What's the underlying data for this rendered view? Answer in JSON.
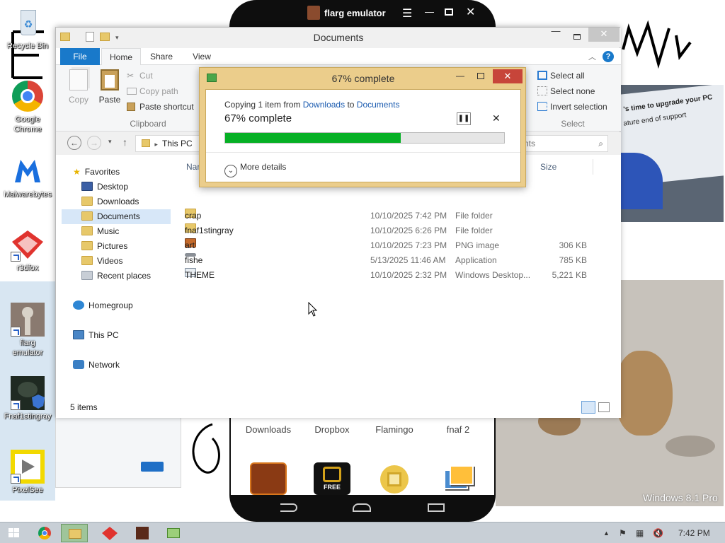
{
  "desktop": {
    "icons": [
      {
        "label": "Recycle Bin"
      },
      {
        "label": "Google Chrome"
      },
      {
        "label": "Malwarebytes"
      },
      {
        "label": "r3dfox"
      },
      {
        "label": "flarg emulator"
      },
      {
        "label": "Fnaf1stingray"
      },
      {
        "label": "PixelSee"
      }
    ],
    "watermark": "Windows 8.1 Pro",
    "bg_text_1": "'s time to upgrade your PC",
    "bg_text_2": "ature end of support"
  },
  "emulator": {
    "title": "flarg emulator",
    "apps": [
      "Downloads",
      "Dropbox",
      "Flamingo",
      "fnaf 2"
    ],
    "app_badge": "FREE"
  },
  "explorer": {
    "title": "Documents",
    "tabs": {
      "file": "File",
      "home": "Home",
      "share": "Share",
      "view": "View"
    },
    "ribbon": {
      "copy": "Copy",
      "paste": "Paste",
      "cut": "Cut",
      "copy_path": "Copy path",
      "paste_shortcut": "Paste shortcut",
      "clipboard_group": "Clipboard",
      "select_all": "Select all",
      "select_none": "Select none",
      "invert_selection": "Invert selection",
      "select_group": "Select"
    },
    "address": {
      "location": "This PC",
      "search_placeholder": "nts"
    },
    "nav": {
      "favorites": "Favorites",
      "desktop": "Desktop",
      "downloads": "Downloads",
      "documents": "Documents",
      "music": "Music",
      "pictures": "Pictures",
      "videos": "Videos",
      "recent": "Recent places",
      "homegroup": "Homegroup",
      "thispc": "This PC",
      "network": "Network"
    },
    "columns": {
      "name": "Nar",
      "size": "Size"
    },
    "files": [
      {
        "name": "crap",
        "date": "10/10/2025 7:42 PM",
        "type": "File folder",
        "size": ""
      },
      {
        "name": "fnaf1stingray",
        "date": "10/10/2025 6:26 PM",
        "type": "File folder",
        "size": ""
      },
      {
        "name": "art",
        "date": "10/10/2025 7:23 PM",
        "type": "PNG image",
        "size": "306 KB"
      },
      {
        "name": "fishe",
        "date": "5/13/2025 11:46 AM",
        "type": "Application",
        "size": "785 KB"
      },
      {
        "name": "THEME",
        "date": "10/10/2025 2:32 PM",
        "type": "Windows Desktop...",
        "size": "5,221 KB"
      }
    ],
    "status": "5 items"
  },
  "copy_dialog": {
    "title": "67% complete",
    "line_prefix": "Copying 1 item from",
    "from": "Downloads",
    "to_word": "to",
    "to": "Documents",
    "headline": "67% complete",
    "progress": 0.63,
    "more_details": "More details"
  },
  "taskbar": {
    "time": "7:42 PM"
  },
  "colors": {
    "accent": "#1979ca",
    "progress": "#06b025",
    "dialog_frame": "#ebcd8b",
    "taskbar": "#c8cfd6"
  }
}
